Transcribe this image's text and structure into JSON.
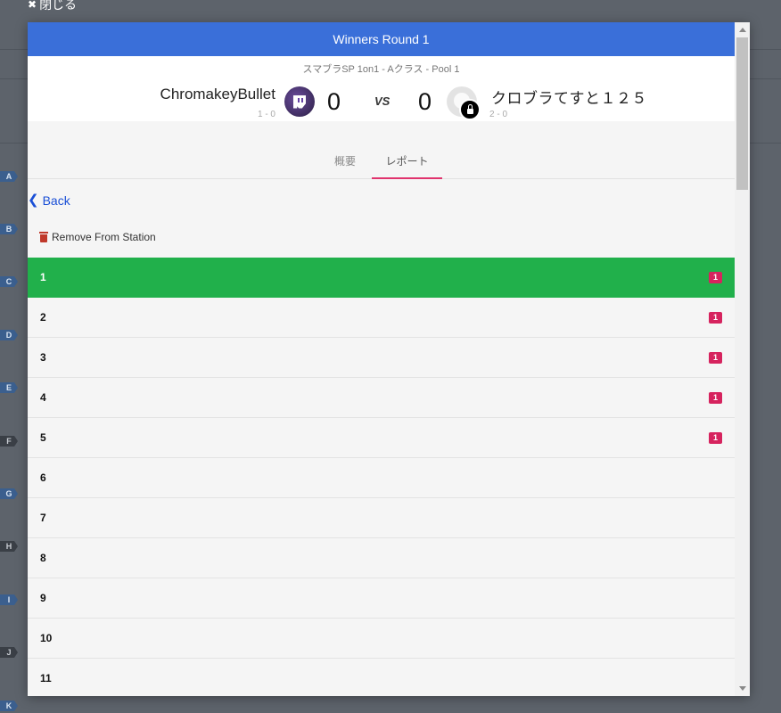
{
  "background": {
    "close_label": "閉じる",
    "left_tags": [
      "A",
      "B",
      "C",
      "D",
      "E",
      "F",
      "G",
      "H",
      "I",
      "J",
      "K"
    ]
  },
  "modal": {
    "title": "Winners Round 1",
    "event_name": "スマブラSP 1on1 - Aクラス - Pool 1",
    "player1": {
      "name": "ChromakeyBullet",
      "record": "1 - 0",
      "score": "0"
    },
    "vs_label": "VS",
    "player2": {
      "name": "クロブラてすと１２５",
      "record": "2 - 0",
      "score": "0"
    },
    "tabs": [
      {
        "label": "概要",
        "active": false
      },
      {
        "label": "レポート",
        "active": true
      }
    ],
    "back_label": "Back",
    "remove_station_label": "Remove From Station",
    "games": [
      {
        "number": "1",
        "badge": "1",
        "active": true
      },
      {
        "number": "2",
        "badge": "1",
        "active": false
      },
      {
        "number": "3",
        "badge": "1",
        "active": false
      },
      {
        "number": "4",
        "badge": "1",
        "active": false
      },
      {
        "number": "5",
        "badge": "1",
        "active": false
      },
      {
        "number": "6",
        "badge": null,
        "active": false
      },
      {
        "number": "7",
        "badge": null,
        "active": false
      },
      {
        "number": "8",
        "badge": null,
        "active": false
      },
      {
        "number": "9",
        "badge": null,
        "active": false
      },
      {
        "number": "10",
        "badge": null,
        "active": false
      },
      {
        "number": "11",
        "badge": null,
        "active": false
      }
    ]
  },
  "colors": {
    "header_blue": "#3a6fd9",
    "active_row_green": "#21b04b",
    "badge_pink": "#d6235e",
    "tab_underline": "#e0336d",
    "link_blue": "#1a4fd6"
  }
}
